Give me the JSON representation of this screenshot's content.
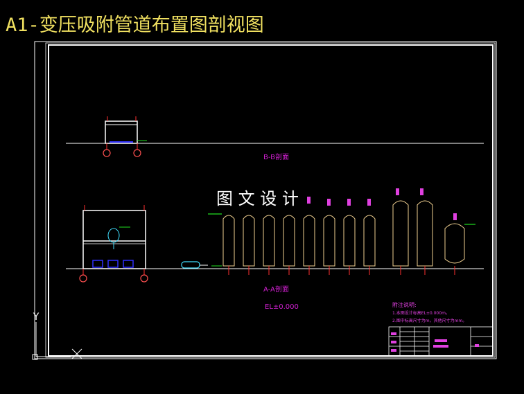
{
  "title": "A1-变压吸附管道布置图剖视图",
  "section_bb": "B-B剖面",
  "section_aa": "A-A剖面",
  "elevation": "EL±0.000",
  "watermark": "图 文 设 计",
  "ucs_axis": "Y",
  "notes": {
    "heading": "附注说明:",
    "line1": "1.本图设计标高EL±0.000m。",
    "line2": "2.图中标高尺寸为m，其他尺寸为mm。"
  },
  "colors": {
    "frame": "#ffffff",
    "section_text": "#d020d0",
    "vessel": "#f0d090",
    "tag": "#e040e0",
    "redline": "#ff3030",
    "green": "#20e020",
    "blue": "#3030ff",
    "cyan": "#40e0ff"
  }
}
